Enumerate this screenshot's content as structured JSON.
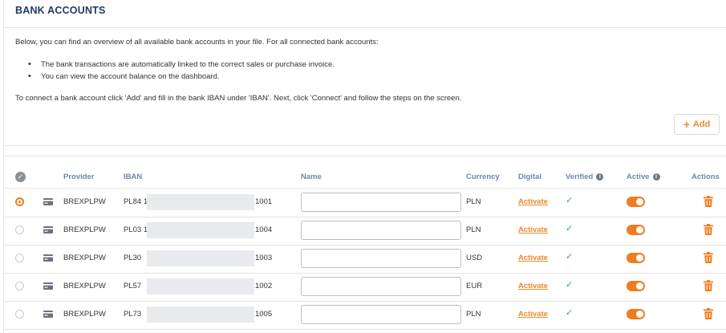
{
  "header": {
    "title": "BANK ACCOUNTS"
  },
  "intro": {
    "text": "Below, you can find an overview of all available bank accounts in your file. For all connected bank accounts:",
    "bullets": [
      "The bank transactions are automatically linked to the correct sales or purchase invoice.",
      "You can view the account balance on the dashboard."
    ],
    "outro": "To connect a bank account click 'Add' and fill in the bank IBAN under 'IBAN'. Next, click 'Connect' and follow the steps on the screen."
  },
  "add_button": {
    "label": "Add",
    "icon": "plus-icon"
  },
  "table": {
    "columns": {
      "provider": "Provider",
      "iban": "IBAN",
      "name": "Name",
      "currency": "Currency",
      "digital": "Digital",
      "verified": "Verified",
      "active": "Active",
      "actions": "Actions"
    },
    "rows": [
      {
        "selected": true,
        "provider": "BREXPLPW",
        "iban_prefix": "PL84 1",
        "iban_suffix": "1001",
        "name": "",
        "currency": "PLN",
        "digital": "Activate",
        "verified": true,
        "active": true
      },
      {
        "selected": false,
        "provider": "BREXPLPW",
        "iban_prefix": "PL03 1",
        "iban_suffix": "1004",
        "name": "",
        "currency": "PLN",
        "digital": "Activate",
        "verified": true,
        "active": true
      },
      {
        "selected": false,
        "provider": "BREXPLPW",
        "iban_prefix": "PL30",
        "iban_suffix": "1003",
        "name": "",
        "currency": "USD",
        "digital": "Activate",
        "verified": true,
        "active": true
      },
      {
        "selected": false,
        "provider": "BREXPLPW",
        "iban_prefix": "PL57",
        "iban_suffix": "1002",
        "name": "",
        "currency": "EUR",
        "digital": "Activate",
        "verified": true,
        "active": true
      },
      {
        "selected": false,
        "provider": "BREXPLPW",
        "iban_prefix": "PL73",
        "iban_suffix": "1005",
        "name": "",
        "currency": "PLN",
        "digital": "Activate",
        "verified": true,
        "active": true
      }
    ]
  },
  "colors": {
    "accent": "#ef7d1f",
    "heading": "#1f3a5f",
    "column_header": "#6f87a8",
    "verified": "#3aa55d"
  }
}
